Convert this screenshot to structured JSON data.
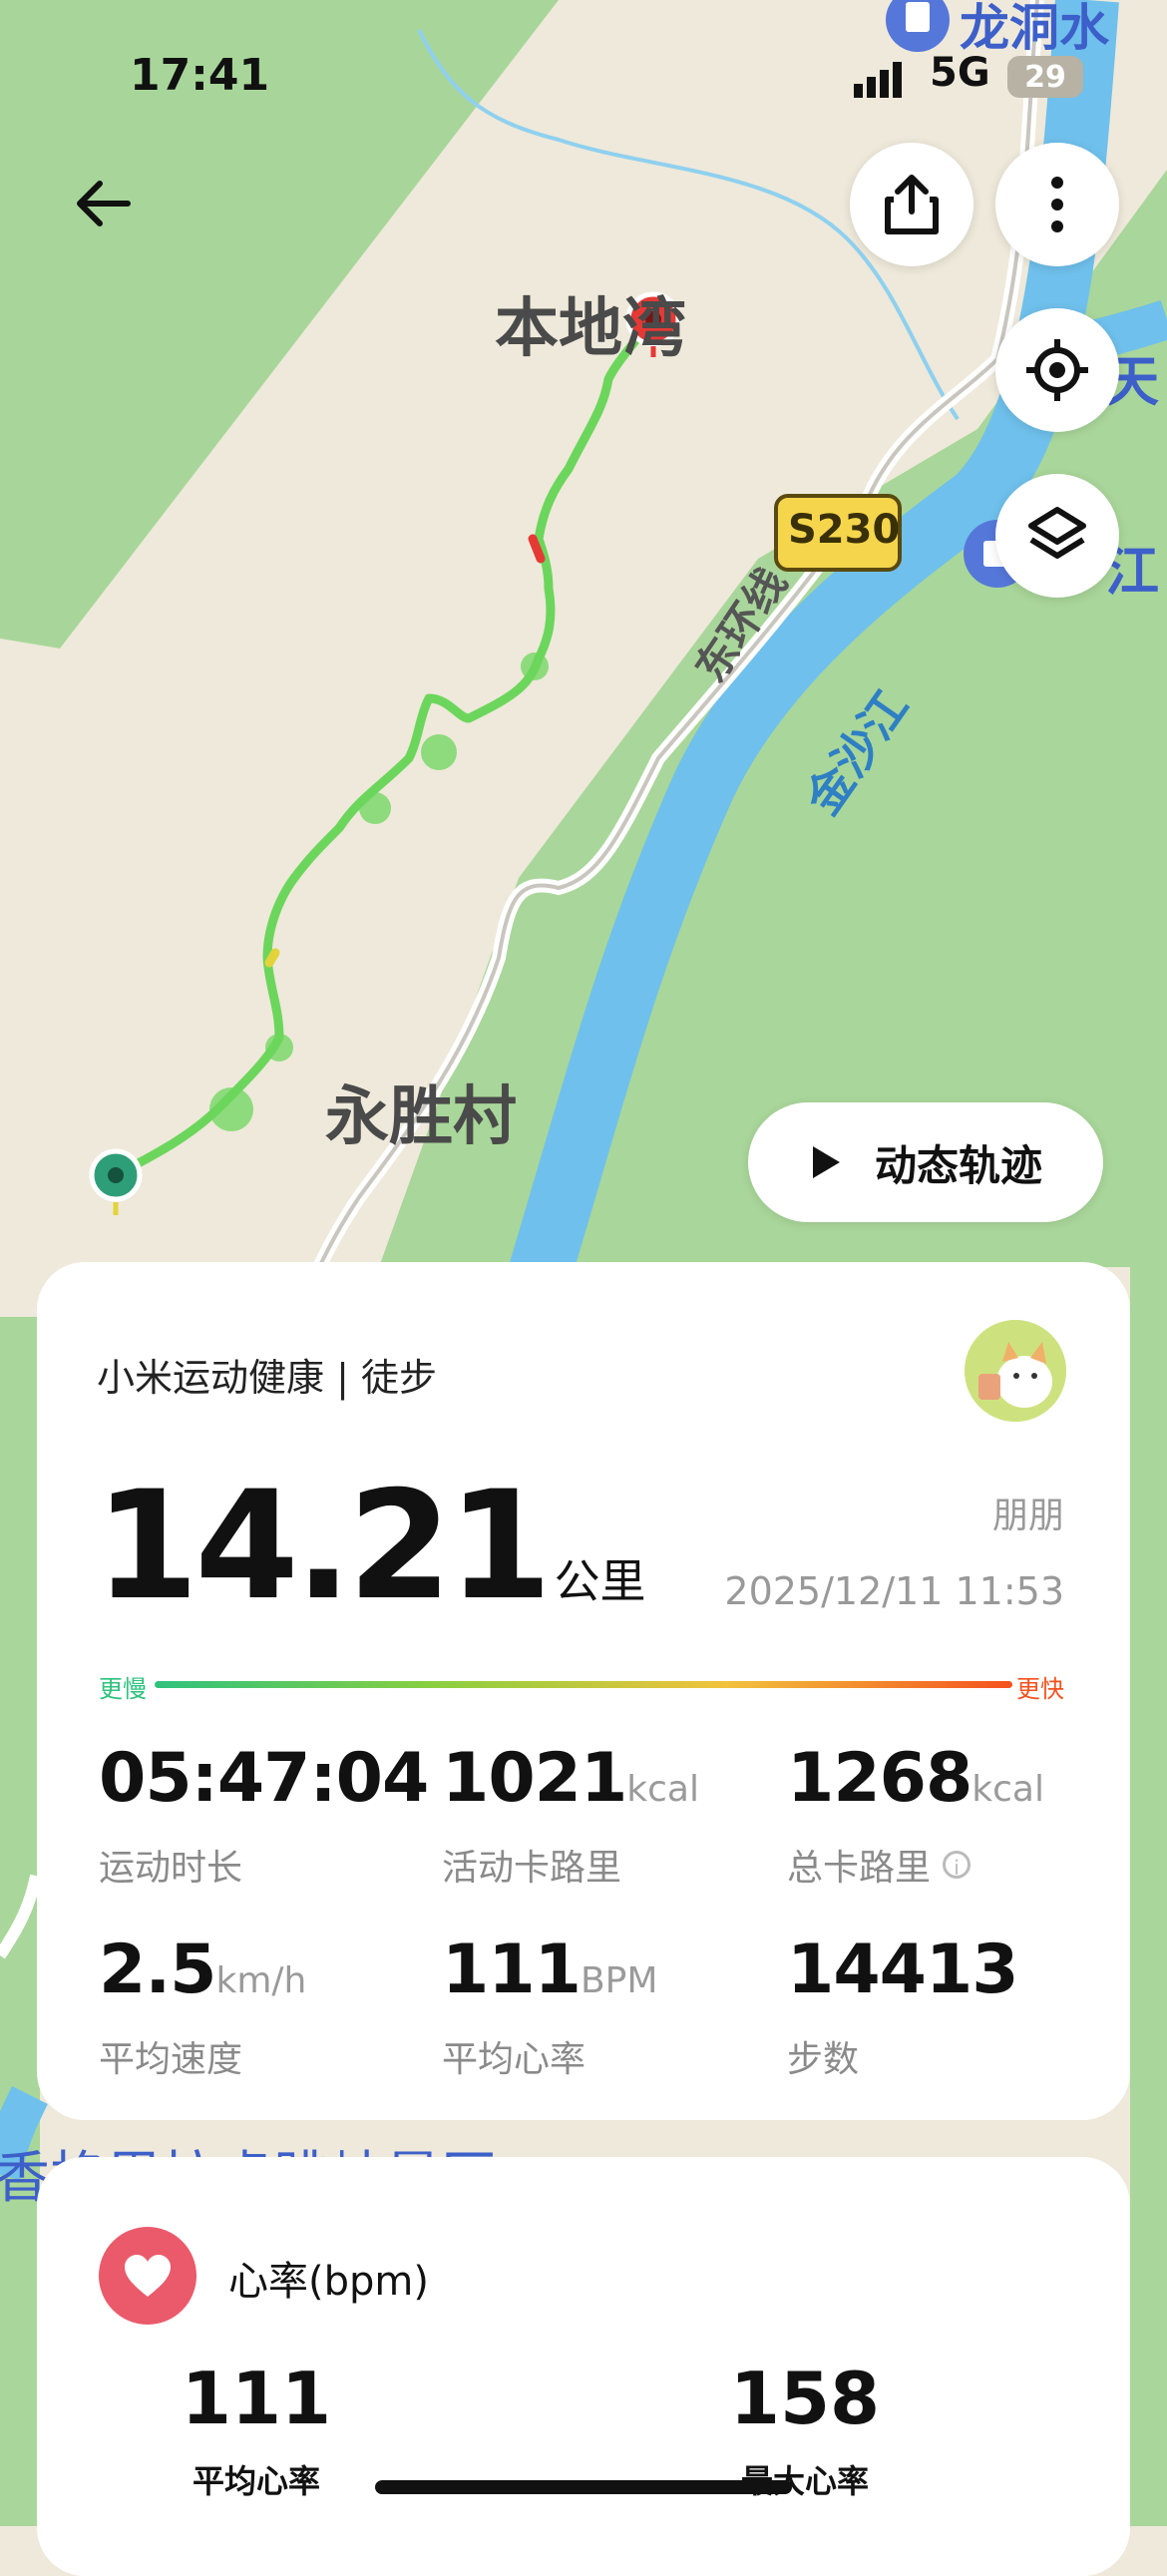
{
  "status_bar": {
    "time": "17:41",
    "network": "5G",
    "battery": "29"
  },
  "map": {
    "labels": {
      "top_poi": "龙洞水",
      "village_1": "本地湾",
      "village_2": "永胜村",
      "road_badge": "S230",
      "road": "东环线",
      "river": "金沙江",
      "right_poi_1": "天",
      "right_poi_2": "江",
      "bottom_poi": "香格里拉虎跳峡景区"
    },
    "play_button_label": "动态轨迹"
  },
  "icons": {
    "back": "arrow-left-icon",
    "share": "share-icon",
    "more": "more-vertical-icon",
    "locate": "locate-target-icon",
    "layers": "layers-icon",
    "play": "play-icon",
    "heart": "heart-icon",
    "info": "info-icon"
  },
  "summary": {
    "app_activity": "小米运动健康 | 徒步",
    "distance": "14.21",
    "distance_unit": "公里",
    "user_name": "朋朋",
    "datetime": "2025/12/11 11:53",
    "pace_slow": "更慢",
    "pace_fast": "更快",
    "stats": [
      {
        "value": "05:47:04",
        "unit": "",
        "label": "运动时长"
      },
      {
        "value": "1021",
        "unit": "kcal",
        "label": "活动卡路里"
      },
      {
        "value": "1268",
        "unit": "kcal",
        "label": "总卡路里"
      },
      {
        "value": "2.5",
        "unit": "km/h",
        "label": "平均速度"
      },
      {
        "value": "111",
        "unit": "BPM",
        "label": "平均心率"
      },
      {
        "value": "14413",
        "unit": "",
        "label": "步数"
      }
    ]
  },
  "heart_rate": {
    "title": "心率(bpm)",
    "avg_value": "111",
    "avg_label": "平均心率",
    "max_value": "158",
    "max_label": "最大心率"
  },
  "colors": {
    "track_green": "#5fd65a",
    "track_red": "#e53935",
    "pace_slow": "#2ec27e",
    "pace_fast": "#f4511e",
    "heart_badge": "#ea5a6b",
    "river": "#6fc0ec",
    "green_area": "#a9d69a"
  }
}
